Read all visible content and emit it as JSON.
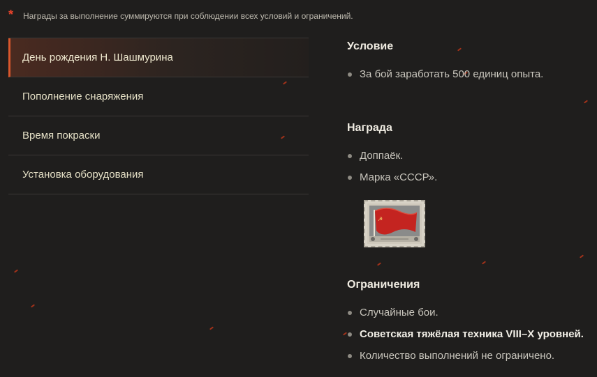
{
  "note": {
    "marker": "*",
    "text": "Награды за выполнение суммируются при соблюдении всех условий и ограничений."
  },
  "menu": {
    "items": [
      {
        "label": "День рождения Н. Шашмурина",
        "active": true
      },
      {
        "label": "Пополнение снаряжения",
        "active": false
      },
      {
        "label": "Время покраски",
        "active": false
      },
      {
        "label": "Установка оборудования",
        "active": false
      }
    ]
  },
  "condition": {
    "title": "Условие",
    "items": [
      "За бой заработать 500 единиц опыта."
    ]
  },
  "reward": {
    "title": "Награда",
    "items": [
      "Доппаёк.",
      "Марка «СССР»."
    ],
    "stamp_icon": "ussr-flag-stamp-icon"
  },
  "restrictions": {
    "title": "Ограничения",
    "items": [
      "Случайные бои.",
      "Советская тяжёлая техника VIII–X уровней.",
      "Количество выполнений не ограничено."
    ]
  },
  "colors": {
    "background": "#1f1e1d",
    "accent": "#d8572c",
    "marker": "#e8432b",
    "ember": "#b8361a"
  }
}
